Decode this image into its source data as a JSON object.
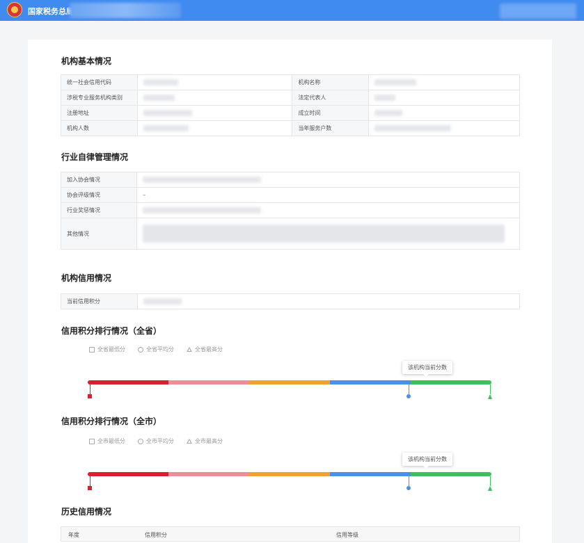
{
  "header": {
    "title": "国家税务总局",
    "bar_color": "#3f8bf0"
  },
  "basic": {
    "title": "机构基本情况",
    "rows": [
      {
        "l1": "统一社会信用代码",
        "l2": "机构名称"
      },
      {
        "l1": "涉税专业服务机构类别",
        "l2": "法定代表人"
      },
      {
        "l1": "注册地址",
        "l2": "成立时间"
      },
      {
        "l1": "机构人数",
        "l2": "当年服务户数"
      }
    ]
  },
  "industry": {
    "title": "行业自律管理情况",
    "rows": [
      {
        "label": "加入协会情况",
        "value": ""
      },
      {
        "label": "协会评级情况",
        "value": "–"
      },
      {
        "label": "行业奖惩情况",
        "value": ""
      },
      {
        "label": "其他情况",
        "value": ""
      }
    ]
  },
  "credit": {
    "title": "机构信用情况",
    "score_label": "当前信用积分"
  },
  "rank_province": {
    "title": "信用积分排行情况（全省）",
    "legend": [
      "全省最低分",
      "全省平均分",
      "全省最高分"
    ],
    "tooltip": "该机构当前分数"
  },
  "rank_city": {
    "title": "信用积分排行情况（全市）",
    "legend": [
      "全市最低分",
      "全市平均分",
      "全市最高分"
    ],
    "tooltip": "该机构当前分数"
  },
  "bar_colors": [
    "#d8202e",
    "#ec8d98",
    "#f0a22e",
    "#4a90e8",
    "#3bc05c"
  ],
  "history": {
    "title": "历史信用情况",
    "columns": [
      "年度",
      "信用积分",
      "信用等级"
    ]
  }
}
